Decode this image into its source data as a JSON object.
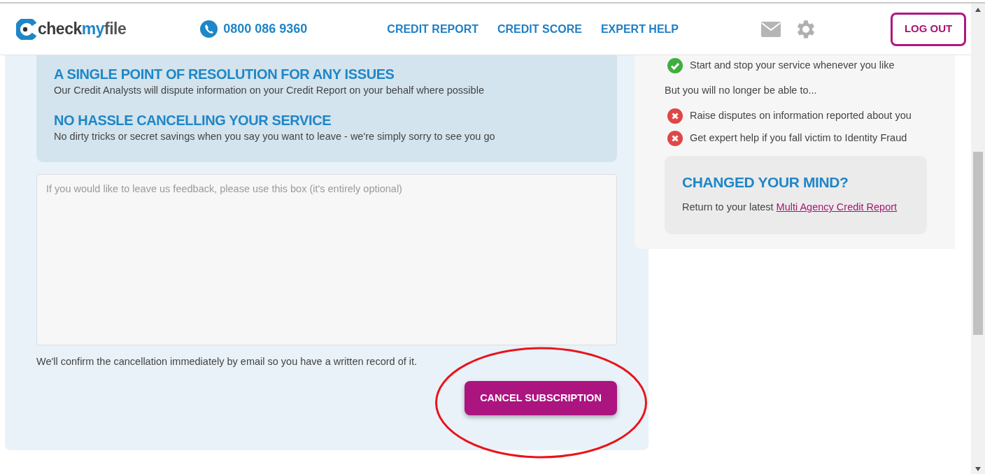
{
  "header": {
    "logo": [
      "check",
      "my",
      "file"
    ],
    "phone": "0800 086 9360",
    "nav": [
      {
        "label": "CREDIT REPORT"
      },
      {
        "label": "CREDIT SCORE"
      },
      {
        "label": "EXPERT HELP"
      }
    ],
    "logout": "LOG OUT"
  },
  "benefits": [
    {
      "title": "A SINGLE POINT OF RESOLUTION FOR ANY ISSUES",
      "text": "Our Credit Analysts will dispute information on your Credit Report on your behalf where possible"
    },
    {
      "title": "NO HASSLE CANCELLING YOUR SERVICE",
      "text": "No dirty tricks or secret savings when you say you want to leave - we're simply sorry to see you go"
    }
  ],
  "feedback": {
    "placeholder": "If you would like to leave us feedback, please use this box (it's entirely optional)"
  },
  "confirm_note": "We'll confirm the cancellation immediately by email so you have a written record of it.",
  "cancel_button": "CANCEL SUBSCRIPTION",
  "summary": {
    "items": [
      {
        "kind": "keep",
        "text": "Start and stop your service whenever you like"
      },
      {
        "kind": "intro",
        "text": "But you will no longer be able to..."
      },
      {
        "kind": "lose",
        "text": "Raise disputes on information reported about you"
      },
      {
        "kind": "lose",
        "text": "Get expert help if you fall victim to Identity Fraud"
      }
    ],
    "changed_mind": {
      "title": "CHANGED YOUR MIND?",
      "text": "Return to your latest",
      "link": "Multi Agency Credit Report"
    }
  }
}
